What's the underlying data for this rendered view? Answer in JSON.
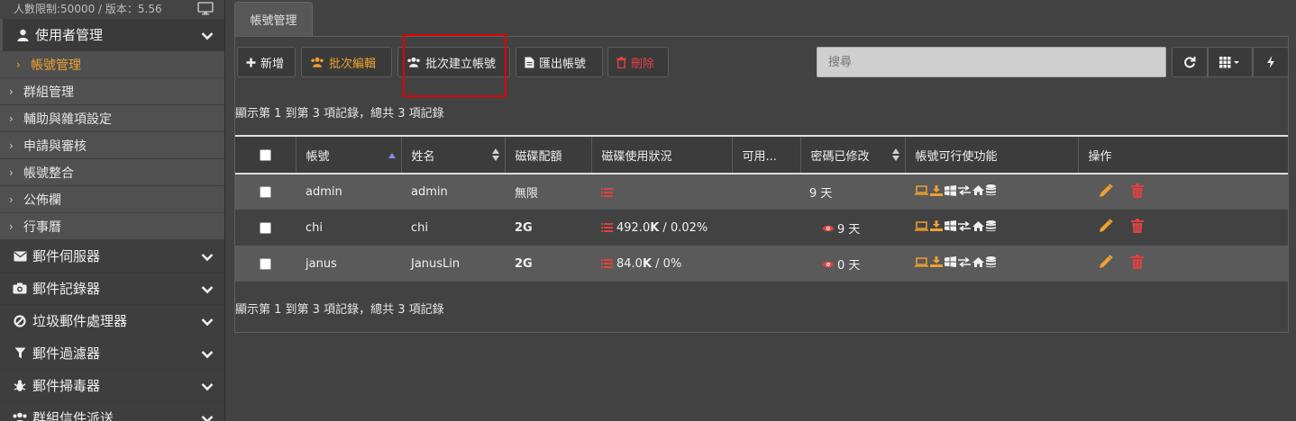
{
  "sidebar": {
    "top_info": "人數限制:50000 / 版本：5.56",
    "sections": [
      {
        "label": "使用者管理",
        "icon": "user-icon",
        "open": true
      },
      {
        "label": "郵件伺服器",
        "icon": "envelope-icon"
      },
      {
        "label": "郵件記錄器",
        "icon": "camera-icon"
      },
      {
        "label": "垃圾郵件處理器",
        "icon": "ban-icon"
      },
      {
        "label": "郵件過濾器",
        "icon": "filter-icon"
      },
      {
        "label": "郵件掃毒器",
        "icon": "bug-icon"
      },
      {
        "label": "群組信件派送",
        "icon": "users-icon"
      }
    ],
    "sub_items": [
      {
        "label": "帳號管理",
        "active": true
      },
      {
        "label": "群組管理"
      },
      {
        "label": "輔助與雜項設定"
      },
      {
        "label": "申請與審核"
      },
      {
        "label": "帳號整合"
      },
      {
        "label": "公佈欄"
      },
      {
        "label": "行事曆"
      }
    ]
  },
  "tab": {
    "label": "帳號管理"
  },
  "toolbar": {
    "add": "新增",
    "batch_edit": "批次編輯",
    "batch_create": "批次建立帳號",
    "export": "匯出帳號",
    "delete": "刪除",
    "search_placeholder": "搜尋"
  },
  "records_info": "顯示第 1 到第 3 項記錄，總共 3 項記錄",
  "table": {
    "columns": [
      "帳號",
      "姓名",
      "磁碟配額",
      "磁碟使用狀況",
      "可用...",
      "密碼已修改",
      "帳號可行使功能",
      "操作"
    ],
    "rows": [
      {
        "account": "admin",
        "name": "admin",
        "quota": "無限",
        "usage_num": "",
        "usage_unit": "",
        "usage_pct": "",
        "pwd_changed": "9 天",
        "show_eye": false
      },
      {
        "account": "chi",
        "name": "chi",
        "quota": "2G",
        "usage_num": "492.0",
        "usage_unit": "K",
        "usage_pct": " / 0.02%",
        "pwd_changed": "9 天",
        "show_eye": true
      },
      {
        "account": "janus",
        "name": "JanusLin",
        "quota": "2G",
        "usage_num": "84.0",
        "usage_unit": "K",
        "usage_pct": " / 0%",
        "pwd_changed": "0 天",
        "show_eye": true
      }
    ]
  },
  "colors": {
    "accent": "#f0a030",
    "danger": "#e04040",
    "highlight": "#e00000"
  }
}
